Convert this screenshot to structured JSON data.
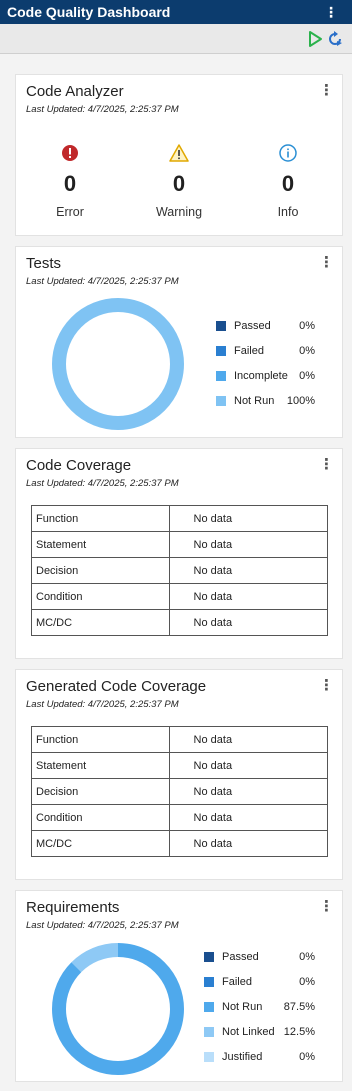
{
  "app": {
    "title": "Code Quality Dashboard",
    "menu_icon": "kebab-icon"
  },
  "toolbar": {
    "run_icon": "run-icon",
    "refresh_icon": "refresh-icon"
  },
  "colors": {
    "titlebar": "#0c3c6e",
    "error": "#c0292b",
    "warning": "#e6b422",
    "info": "#2a8fd4",
    "run": "#2bb24c",
    "passed": "#1a4f8f",
    "failed": "#2a7fd1",
    "incomplete": "#4fa9ec",
    "not_run": "#7fc3f3",
    "not_linked": "#8ec9f5",
    "justified": "#b9defa"
  },
  "code_analyzer": {
    "title": "Code Analyzer",
    "updated": "Last Updated: 4/7/2025, 2:25:37 PM",
    "items": [
      {
        "icon": "error-icon",
        "count": "0",
        "label": "Error"
      },
      {
        "icon": "warning-icon",
        "count": "0",
        "label": "Warning"
      },
      {
        "icon": "info-icon",
        "count": "0",
        "label": "Info"
      }
    ]
  },
  "tests": {
    "title": "Tests",
    "updated": "Last Updated: 4/7/2025, 2:25:37 PM",
    "legend": [
      {
        "label": "Passed",
        "value": "0%",
        "color": "#1a4f8f"
      },
      {
        "label": "Failed",
        "value": "0%",
        "color": "#2a7fd1"
      },
      {
        "label": "Incomplete",
        "value": "0%",
        "color": "#4fa9ec"
      },
      {
        "label": "Not Run",
        "value": "100%",
        "color": "#7fc3f3"
      }
    ],
    "ring_segments": [
      {
        "fraction": 1.0,
        "color": "#7fc3f3"
      }
    ]
  },
  "code_coverage": {
    "title": "Code Coverage",
    "updated": "Last Updated: 4/7/2025, 2:25:37 PM",
    "rows": [
      {
        "metric": "Function",
        "value": "No data"
      },
      {
        "metric": "Statement",
        "value": "No data"
      },
      {
        "metric": "Decision",
        "value": "No data"
      },
      {
        "metric": "Condition",
        "value": "No data"
      },
      {
        "metric": "MC/DC",
        "value": "No data"
      }
    ]
  },
  "generated_coverage": {
    "title": "Generated Code Coverage",
    "updated": "Last Updated: 4/7/2025, 2:25:37 PM",
    "rows": [
      {
        "metric": "Function",
        "value": "No data"
      },
      {
        "metric": "Statement",
        "value": "No data"
      },
      {
        "metric": "Decision",
        "value": "No data"
      },
      {
        "metric": "Condition",
        "value": "No data"
      },
      {
        "metric": "MC/DC",
        "value": "No data"
      }
    ]
  },
  "requirements": {
    "title": "Requirements",
    "updated": "Last Updated: 4/7/2025, 2:25:37 PM",
    "legend": [
      {
        "label": "Passed",
        "value": "0%",
        "color": "#1a4f8f"
      },
      {
        "label": "Failed",
        "value": "0%",
        "color": "#2a7fd1"
      },
      {
        "label": "Not Run",
        "value": "87.5%",
        "color": "#4fa9ec"
      },
      {
        "label": "Not Linked",
        "value": "12.5%",
        "color": "#8ec9f5"
      },
      {
        "label": "Justified",
        "value": "0%",
        "color": "#b9defa"
      }
    ],
    "ring_segments": [
      {
        "fraction": 0.875,
        "color": "#4fa9ec"
      },
      {
        "fraction": 0.125,
        "color": "#8ec9f5"
      }
    ]
  }
}
